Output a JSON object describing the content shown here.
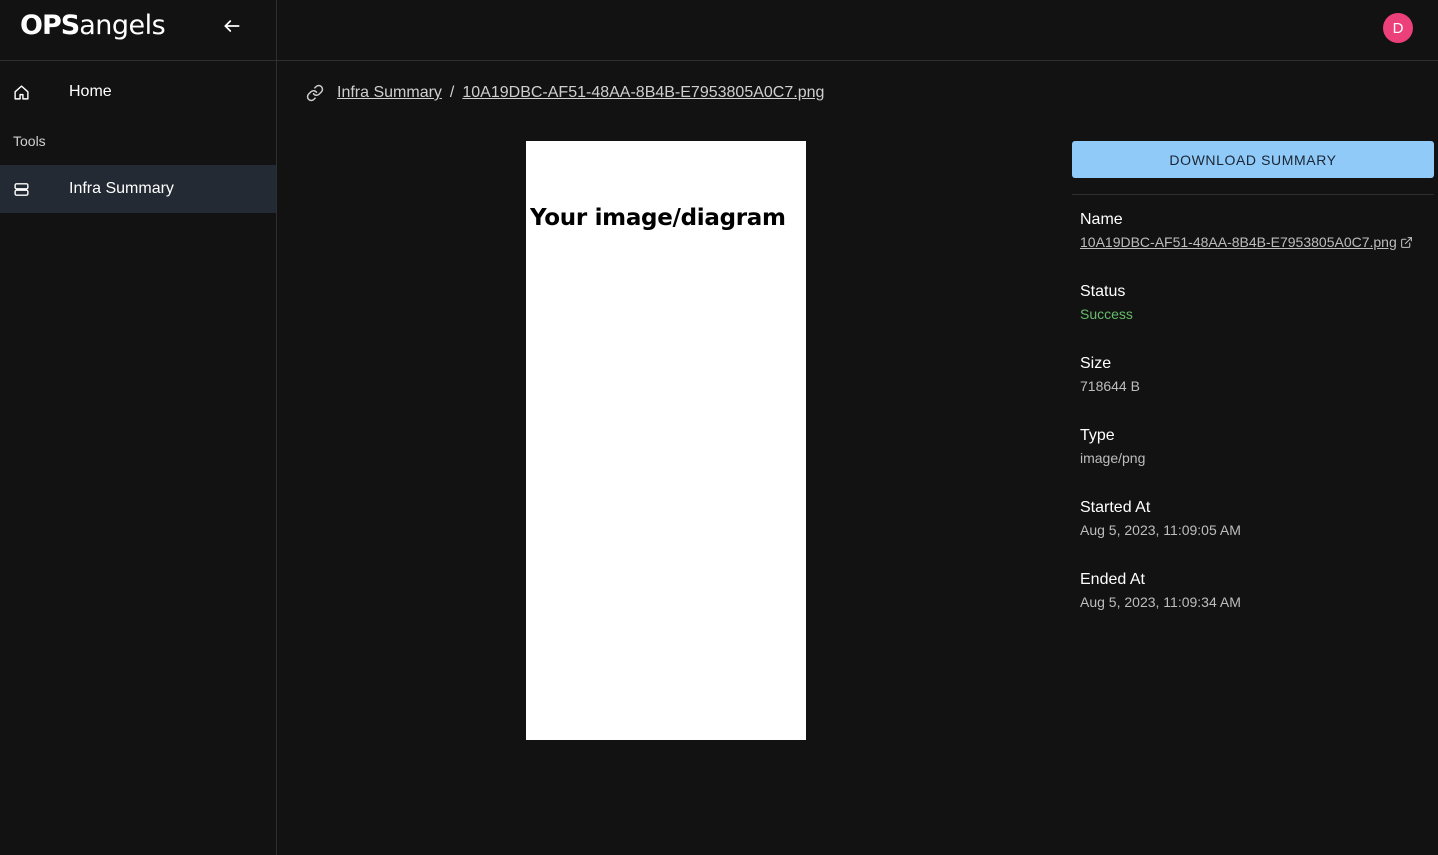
{
  "brand": {
    "logo_ops": "OPS",
    "logo_rest": "angels"
  },
  "sidebar": {
    "collapse_icon": "arrow-left-icon",
    "items": [
      {
        "label": "Home",
        "icon": "home-icon"
      },
      {
        "label": "Infra Summary",
        "icon": "server-icon",
        "active": true
      }
    ],
    "section_label": "Tools"
  },
  "topbar": {
    "avatar_initial": "D",
    "avatar_color": "#ec407a"
  },
  "breadcrumb": {
    "icon": "link-icon",
    "parent": "Infra Summary",
    "separator": "/",
    "current": "10A19DBC-AF51-48AA-8B4B-E7953805A0C7.png"
  },
  "preview": {
    "text": "Your image/diagram"
  },
  "details": {
    "download_label": "DOWNLOAD SUMMARY",
    "fields": {
      "name": {
        "label": "Name",
        "value": "10A19DBC-AF51-48AA-8B4B-E7953805A0C7.png"
      },
      "status": {
        "label": "Status",
        "value": "Success"
      },
      "size": {
        "label": "Size",
        "value": "718644 B"
      },
      "type": {
        "label": "Type",
        "value": "image/png"
      },
      "started": {
        "label": "Started At",
        "value": "Aug 5, 2023, 11:09:05 AM"
      },
      "ended": {
        "label": "Ended At",
        "value": "Aug 5, 2023, 11:09:34 AM"
      }
    }
  },
  "colors": {
    "background": "#121212",
    "active_nav": "#232a33",
    "accent_button": "#90caf9",
    "success": "#66bb6a"
  }
}
